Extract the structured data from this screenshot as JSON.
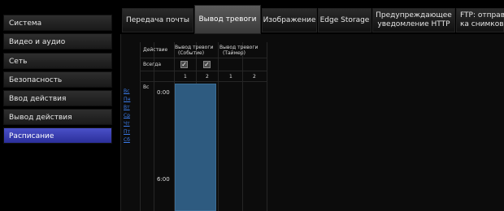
{
  "sidebar": {
    "items": [
      {
        "label": "Система"
      },
      {
        "label": "Видео и аудио"
      },
      {
        "label": "Сеть"
      },
      {
        "label": "Безопасность"
      },
      {
        "label": "Ввод действия"
      },
      {
        "label": "Вывод действия"
      },
      {
        "label": "Расписание",
        "active": true
      }
    ]
  },
  "tabs": [
    {
      "label": "Передача почты"
    },
    {
      "label": "Вывод тревоги",
      "active": true
    },
    {
      "label": "Изображение"
    },
    {
      "label": "Edge Storage"
    },
    {
      "label_line1": "Предупреждающее",
      "label_line2": "уведомление HTTP"
    },
    {
      "label_line1": "FTP: отправ",
      "label_line2": "ка снимков"
    }
  ],
  "schedule": {
    "header": {
      "action": "Действие",
      "col1_line1": "Вывод тревоги",
      "col1_line2": "(Событие)",
      "col2_line1": "Вывод тревоги",
      "col2_line2": "(Таймер)",
      "always": "Всегда",
      "check1": "✓",
      "check2": "✓",
      "sub1": "1",
      "sub2": "2",
      "sub3": "1",
      "sub4": "2"
    },
    "day_label": "Вс",
    "times": [
      "0:00",
      "6:00"
    ],
    "days": [
      "Вс",
      "Пн",
      "Вт",
      "Ср",
      "Чт",
      "Пт",
      "Сб"
    ]
  }
}
